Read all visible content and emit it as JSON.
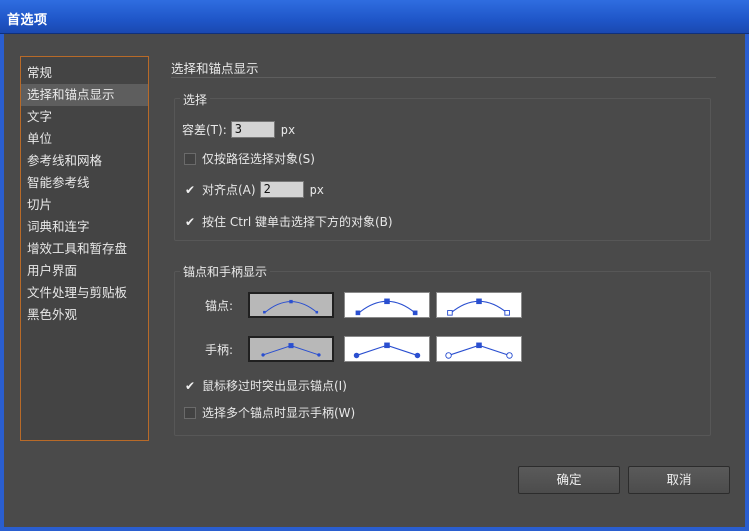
{
  "window": {
    "title": "首选项"
  },
  "sidebar": {
    "items": [
      {
        "label": "常规",
        "selected": false
      },
      {
        "label": "选择和锚点显示",
        "selected": true
      },
      {
        "label": "文字",
        "selected": false
      },
      {
        "label": "单位",
        "selected": false
      },
      {
        "label": "参考线和网格",
        "selected": false
      },
      {
        "label": "智能参考线",
        "selected": false
      },
      {
        "label": "切片",
        "selected": false
      },
      {
        "label": "词典和连字",
        "selected": false
      },
      {
        "label": "增效工具和暂存盘",
        "selected": false
      },
      {
        "label": "用户界面",
        "selected": false
      },
      {
        "label": "文件处理与剪贴板",
        "selected": false
      },
      {
        "label": "黑色外观",
        "selected": false
      }
    ]
  },
  "panel": {
    "title": "选择和锚点显示"
  },
  "selection": {
    "title": "选择",
    "tolerance_label": "容差(T):",
    "tolerance_value": "3",
    "tolerance_unit": "px",
    "path_only_label": "仅按路径选择对象(S)",
    "path_only_checked": false,
    "snap_label": "对齐点(A)",
    "snap_checked": true,
    "snap_value": "2",
    "snap_unit": "px",
    "ctrl_click_label": "按住 Ctrl 键单击选择下方的对象(B)",
    "ctrl_click_checked": true
  },
  "anchor": {
    "title": "锚点和手柄显示",
    "anchors_label": "锚点:",
    "handles_label": "手柄:",
    "anchor_selected_index": 0,
    "handle_selected_index": 0,
    "highlight_label": "鼠标移过时突出显示锚点(I)",
    "highlight_checked": true,
    "multi_handles_label": "选择多个锚点时显示手柄(W)",
    "multi_handles_checked": false
  },
  "buttons": {
    "ok": "确定",
    "cancel": "取消"
  },
  "colors": {
    "title_bar": "#1f56c8",
    "sidebar_border": "#b86a28",
    "glyph_blue": "#2a4fd0"
  },
  "icons": {
    "check": "check-icon"
  }
}
